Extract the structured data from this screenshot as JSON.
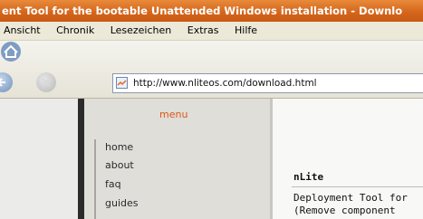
{
  "window": {
    "title": "ent Tool for the bootable Unattended Windows installation - Downlo"
  },
  "menubar": {
    "items": [
      "Ansicht",
      "Chronik",
      "Lesezeichen",
      "Extras",
      "Hilfe"
    ]
  },
  "toolbar": {
    "back_icon": "back-arrow-icon",
    "stop_icon": "stop-icon",
    "home_icon": "home-icon",
    "url": "http://www.nliteos.com/download.html",
    "page_icon": "page-icon"
  },
  "sidebar": {
    "menu_title": "menu",
    "items": [
      "home",
      "about",
      "faq",
      "guides"
    ]
  },
  "main": {
    "heading": "nLite",
    "description_line1": "Deployment Tool for",
    "description_line2": "(Remove component"
  },
  "colors": {
    "titlebar": "#d4641a",
    "menu_title": "#e0551a",
    "sidebar_bg": "#dfded9"
  }
}
